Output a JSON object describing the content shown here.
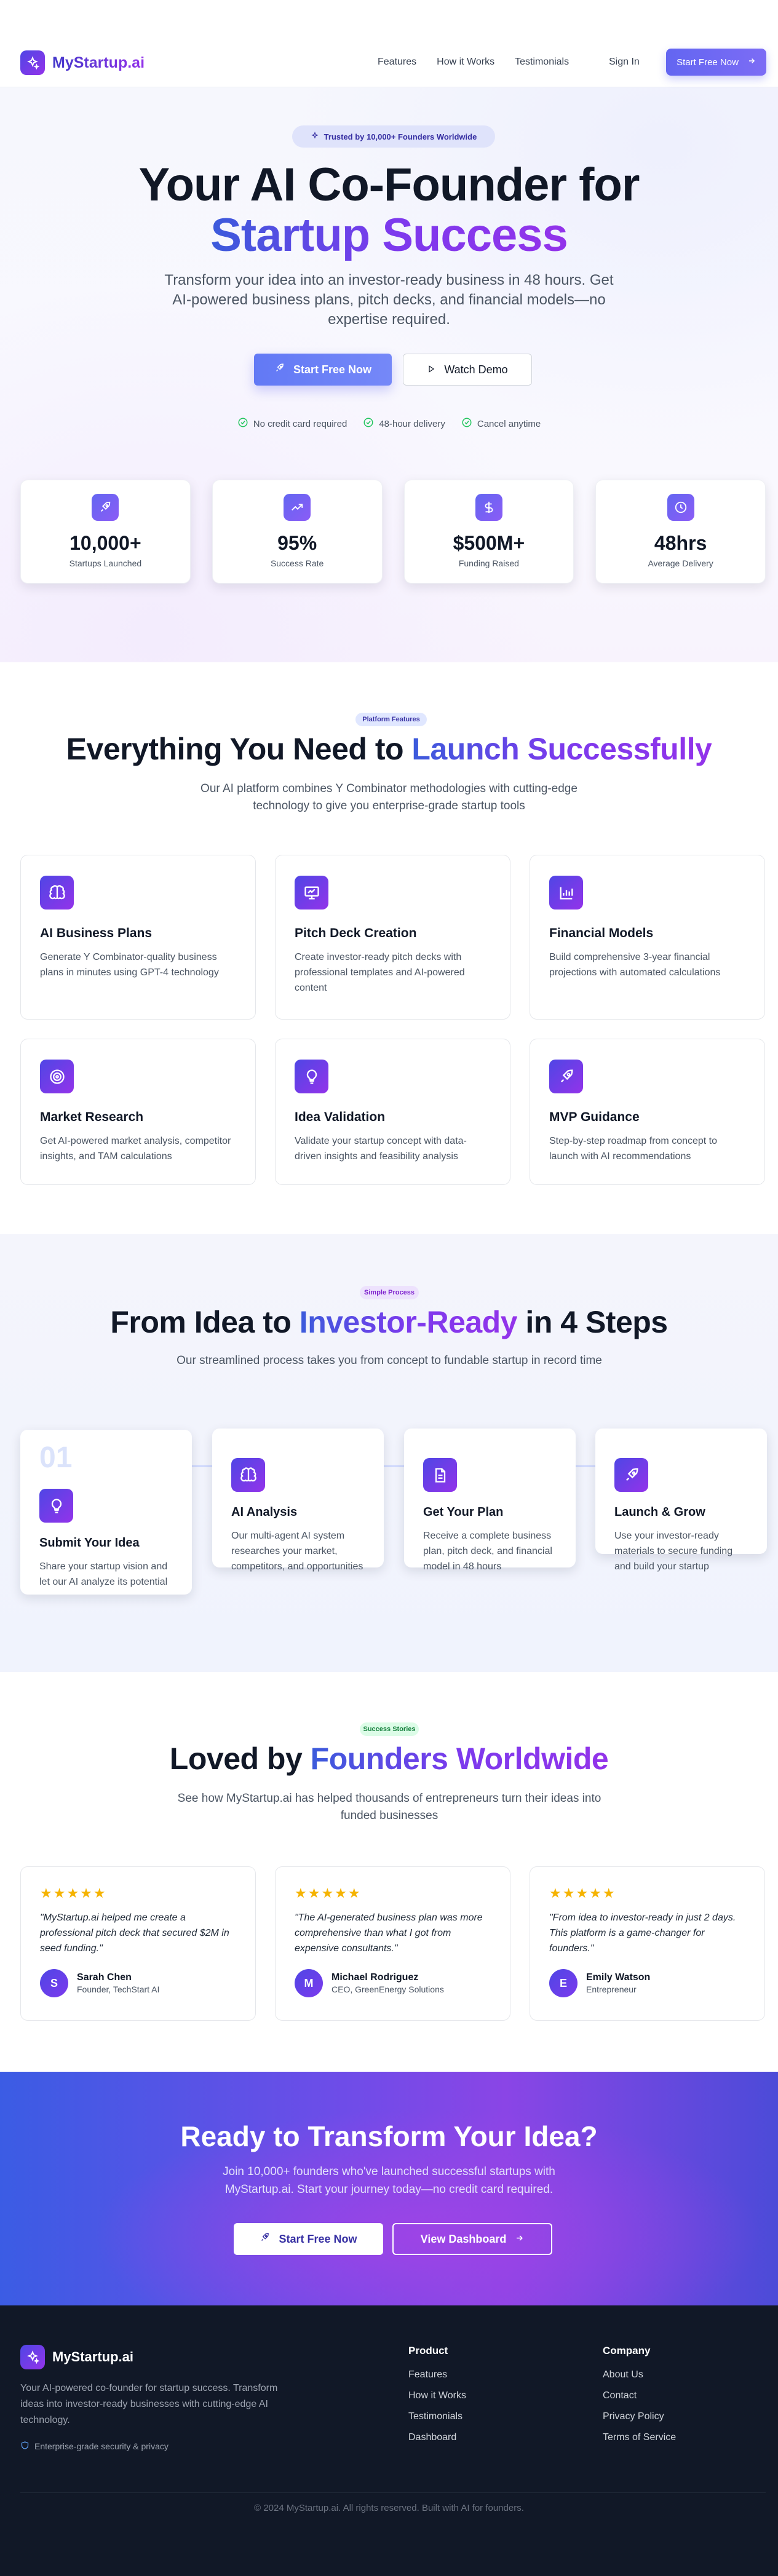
{
  "nav": {
    "brand": "MyStartup.ai",
    "links": [
      "Features",
      "How it Works",
      "Testimonials"
    ],
    "signin": "Sign In",
    "cta": "Start Free Now"
  },
  "hero": {
    "badge": "Trusted by 10,000+ Founders Worldwide",
    "title_line1": "Your AI Co-Founder for",
    "title_line2": "Startup Success",
    "subtitle": "Transform your idea into an investor-ready business in 48 hours. Get AI-powered business plans, pitch decks, and financial models—no expertise required.",
    "primary_button": "Start Free Now",
    "secondary_button": "Watch Demo",
    "checks": [
      "No credit card required",
      "48-hour delivery",
      "Cancel anytime"
    ],
    "stats": [
      {
        "value": "10,000+",
        "label": "Startups Launched",
        "icon": "rocket-icon"
      },
      {
        "value": "95%",
        "label": "Success Rate",
        "icon": "trending-up-icon"
      },
      {
        "value": "$500M+",
        "label": "Funding Raised",
        "icon": "dollar-icon"
      },
      {
        "value": "48hrs",
        "label": "Average Delivery",
        "icon": "clock-icon"
      }
    ]
  },
  "features": {
    "tag": "Platform Features",
    "title_plain": "Everything You Need to ",
    "title_grad": "Launch Successfully",
    "subtitle": "Our AI platform combines Y Combinator methodologies with cutting-edge technology to give you enterprise-grade startup tools",
    "items": [
      {
        "title": "AI Business Plans",
        "desc": "Generate Y Combinator-quality business plans in minutes using GPT-4 technology",
        "icon": "brain-icon"
      },
      {
        "title": "Pitch Deck Creation",
        "desc": "Create investor-ready pitch decks with professional templates and AI-powered content",
        "icon": "presentation-icon"
      },
      {
        "title": "Financial Models",
        "desc": "Build comprehensive 3-year financial projections with automated calculations",
        "icon": "bar-chart-icon"
      },
      {
        "title": "Market Research",
        "desc": "Get AI-powered market analysis, competitor insights, and TAM calculations",
        "icon": "target-icon"
      },
      {
        "title": "Idea Validation",
        "desc": "Validate your startup concept with data-driven insights and feasibility analysis",
        "icon": "lightbulb-icon"
      },
      {
        "title": "MVP Guidance",
        "desc": "Step-by-step roadmap from concept to launch with AI recommendations",
        "icon": "rocket-icon"
      }
    ]
  },
  "steps": {
    "tag": "Simple Process",
    "title_plain1": "From Idea to ",
    "title_grad": "Investor-Ready",
    "title_plain2": " in 4 Steps",
    "subtitle": "Our streamlined process takes you from concept to fundable startup in record time",
    "first_number": "01",
    "items": [
      {
        "title": "Submit Your Idea",
        "desc": "Share your startup vision and let our AI analyze its potential",
        "icon": "lightbulb-icon"
      },
      {
        "title": "AI Analysis",
        "desc": "Our multi-agent AI system researches your market, competitors, and opportunities",
        "icon": "brain-icon"
      },
      {
        "title": "Get Your Plan",
        "desc": "Receive a complete business plan, pitch deck, and financial model in 48 hours",
        "icon": "document-icon"
      },
      {
        "title": "Launch & Grow",
        "desc": "Use your investor-ready materials to secure funding and build your startup",
        "icon": "rocket-icon"
      }
    ]
  },
  "testimonials": {
    "tag": "Success Stories",
    "title_plain": "Loved by ",
    "title_grad": "Founders Worldwide",
    "subtitle": "See how MyStartup.ai has helped thousands of entrepreneurs turn their ideas into funded businesses",
    "stars": "★★★★★",
    "items": [
      {
        "quote": "\"MyStartup.ai helped me create a professional pitch deck that secured $2M in seed funding.\"",
        "initial": "S",
        "name": "Sarah Chen",
        "role": "Founder, TechStart AI"
      },
      {
        "quote": "\"The AI-generated business plan was more comprehensive than what I got from expensive consultants.\"",
        "initial": "M",
        "name": "Michael Rodriguez",
        "role": "CEO, GreenEnergy Solutions"
      },
      {
        "quote": "\"From idea to investor-ready in just 2 days. This platform is a game-changer for founders.\"",
        "initial": "E",
        "name": "Emily Watson",
        "role": "Entrepreneur"
      }
    ]
  },
  "cta": {
    "title": "Ready to Transform Your Idea?",
    "subtitle": "Join 10,000+ founders who've launched successful startups with MyStartup.ai. Start your journey today—no credit card required.",
    "primary": "Start Free Now",
    "secondary": "View Dashboard"
  },
  "footer": {
    "brand": "MyStartup.ai",
    "desc": "Your AI-powered co-founder for startup success. Transform ideas into investor-ready businesses with cutting-edge AI technology.",
    "security": "Enterprise-grade security & privacy",
    "product_title": "Product",
    "product_links": [
      "Features",
      "How it Works",
      "Testimonials",
      "Dashboard"
    ],
    "company_title": "Company",
    "company_links": [
      "About Us",
      "Contact",
      "Privacy Policy",
      "Terms of Service"
    ],
    "copyright": "© 2024 MyStartup.ai. All rights reserved. Built with AI for founders."
  },
  "colors": {
    "accent_indigo": "#4f46e5",
    "accent_purple": "#9333ea",
    "star": "#f5b301",
    "check_green": "#22c55e",
    "footer_bg": "#111827"
  }
}
